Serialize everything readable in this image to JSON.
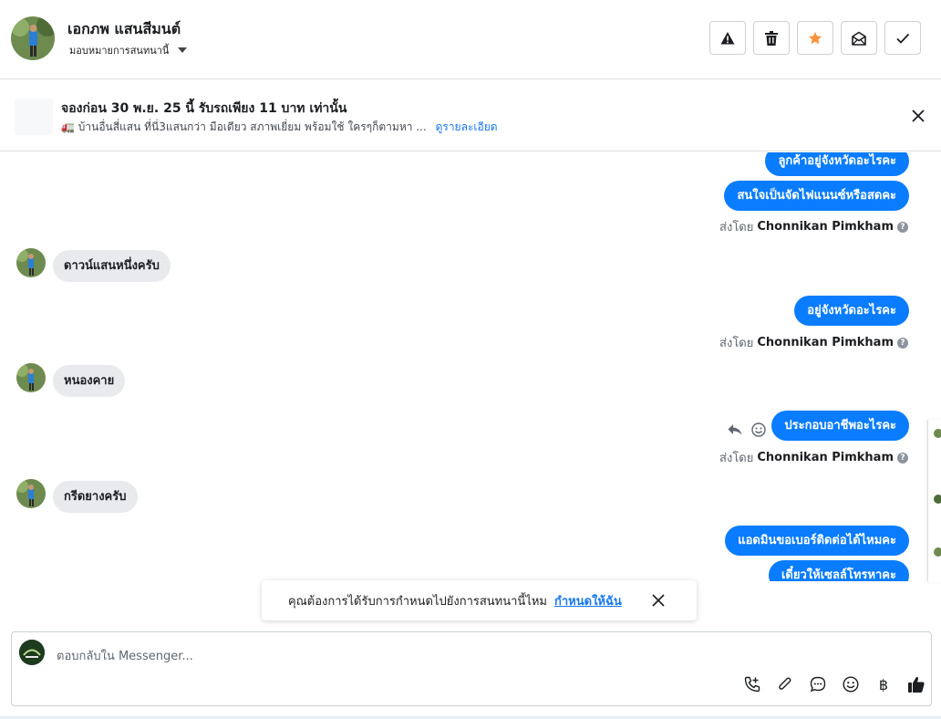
{
  "header": {
    "name": "เอกภพ แสนสีมนต์",
    "assign_label": "มอบหมายการสนทนานี้",
    "actions": [
      {
        "name": "report-spam",
        "icon": "warning-icon"
      },
      {
        "name": "delete",
        "icon": "trash-icon"
      },
      {
        "name": "star",
        "icon": "star-icon",
        "color": "#f7923b"
      },
      {
        "name": "mark-unread",
        "icon": "envelope-open-icon"
      },
      {
        "name": "mark-done",
        "icon": "check-icon"
      }
    ]
  },
  "ad": {
    "title": "จองก่อน 30 พ.ย. 25 นี้ รับรถเพียง 11 บาท เท่านั้น",
    "description": "🚛 บ้านอื่นสี่แสน ที่นี่3แสนกว่า มือเดียว สภาพเยี่ยม พร้อมใช้ ใครๆก็ตามหา ...",
    "link": "ดูรายละเอียด"
  },
  "messages": {
    "out_1": "ลูกค้าอยู่จังหวัดอะไรคะ",
    "out_2": "สนใจเป็นจัดไฟแนนซ์หรือสดคะ",
    "sent_prefix": "ส่งโดย",
    "sender": "Chonnikan Pimkham",
    "in_1": "ดาวน์แสนหนึ่งครับ",
    "out_3": "อยู่จังหวัดอะไรคะ",
    "in_2": "หนองคาย",
    "out_4": "ประกอบอาชีพอะไรคะ",
    "in_3": "กรีดยางครับ",
    "out_5": "แอดมินขอเบอร์ติดต่อได้ไหมคะ",
    "out_6": "เดี๋ยวให้เซลล์โทรหาคะ"
  },
  "toast": {
    "text": "คุณต้องการได้รับการกำหนดไปยังการสนทนานี้ไหม",
    "link": "กำหนดให้ฉัน"
  },
  "composer": {
    "placeholder": "ตอบกลับใน Messenger...",
    "tools": [
      "call-add-icon",
      "attachment-icon",
      "saved-reply-icon",
      "emoji-icon",
      "baht-icon",
      "thumbs-up-icon"
    ],
    "baht_symbol": "฿"
  },
  "colors": {
    "accent": "#0a7cff",
    "link": "#1877f2",
    "star": "#f7923b"
  }
}
